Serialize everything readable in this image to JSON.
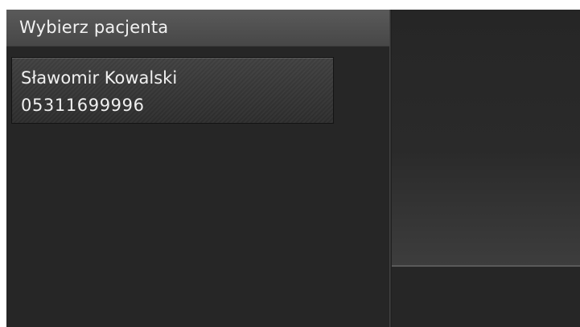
{
  "header": {
    "title": "Wybierz pacjenta"
  },
  "patients": [
    {
      "name": "Sławomir Kowalski",
      "id": "05311699996"
    }
  ]
}
